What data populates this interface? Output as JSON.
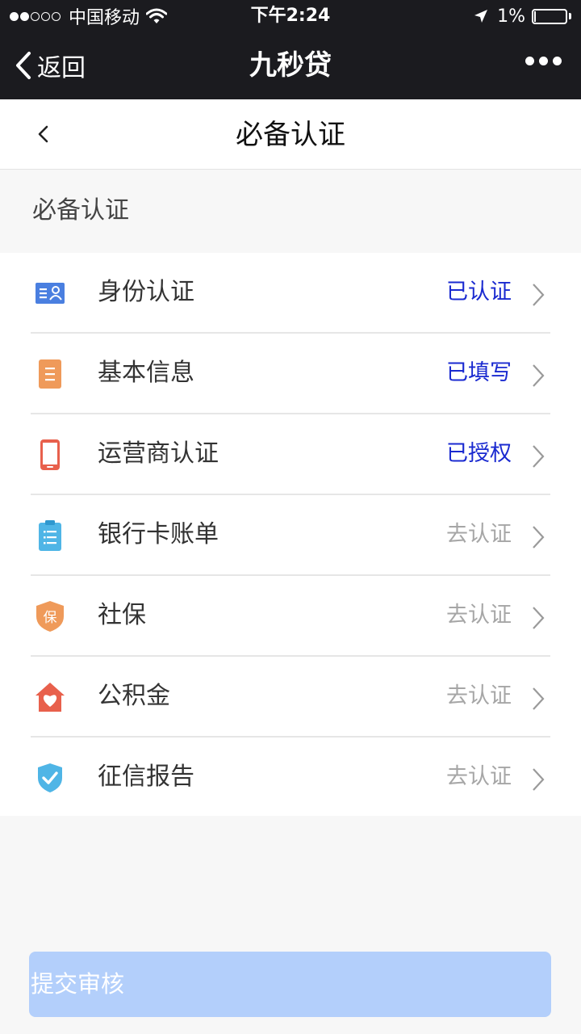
{
  "status_bar": {
    "carrier": "中国移动",
    "time": "下午2:24",
    "battery": "1%",
    "battery_level": 0.01
  },
  "app_bar": {
    "back_label": "返回",
    "title": "九秒贷"
  },
  "page": {
    "title": "必备认证",
    "section_title": "必备认证"
  },
  "items": [
    {
      "label": "身份认证",
      "status": "已认证",
      "state": "done",
      "icon": "id-card-icon",
      "color": "#4a7fe0"
    },
    {
      "label": "基本信息",
      "status": "已填写",
      "state": "done",
      "icon": "document-icon",
      "color": "#ef9a5a"
    },
    {
      "label": "运营商认证",
      "status": "已授权",
      "state": "done",
      "icon": "phone-icon",
      "color": "#e8604c"
    },
    {
      "label": "银行卡账单",
      "status": "去认证",
      "state": "todo",
      "icon": "clipboard-icon",
      "color": "#4fb5e6"
    },
    {
      "label": "社保",
      "status": "去认证",
      "state": "todo",
      "icon": "shield-bao-icon",
      "color": "#ef9a5a"
    },
    {
      "label": "公积金",
      "status": "去认证",
      "state": "todo",
      "icon": "house-heart-icon",
      "color": "#e8604c"
    },
    {
      "label": "征信报告",
      "status": "去认证",
      "state": "todo",
      "icon": "shield-check-icon",
      "color": "#4fb5e6"
    }
  ],
  "colors": {
    "done_status": "#1a2ad0",
    "todo_status": "#a6a6a6",
    "submit_bg": "#b3cffb",
    "bar_bg": "#1b1b1f"
  },
  "submit": {
    "label": "提交审核"
  }
}
